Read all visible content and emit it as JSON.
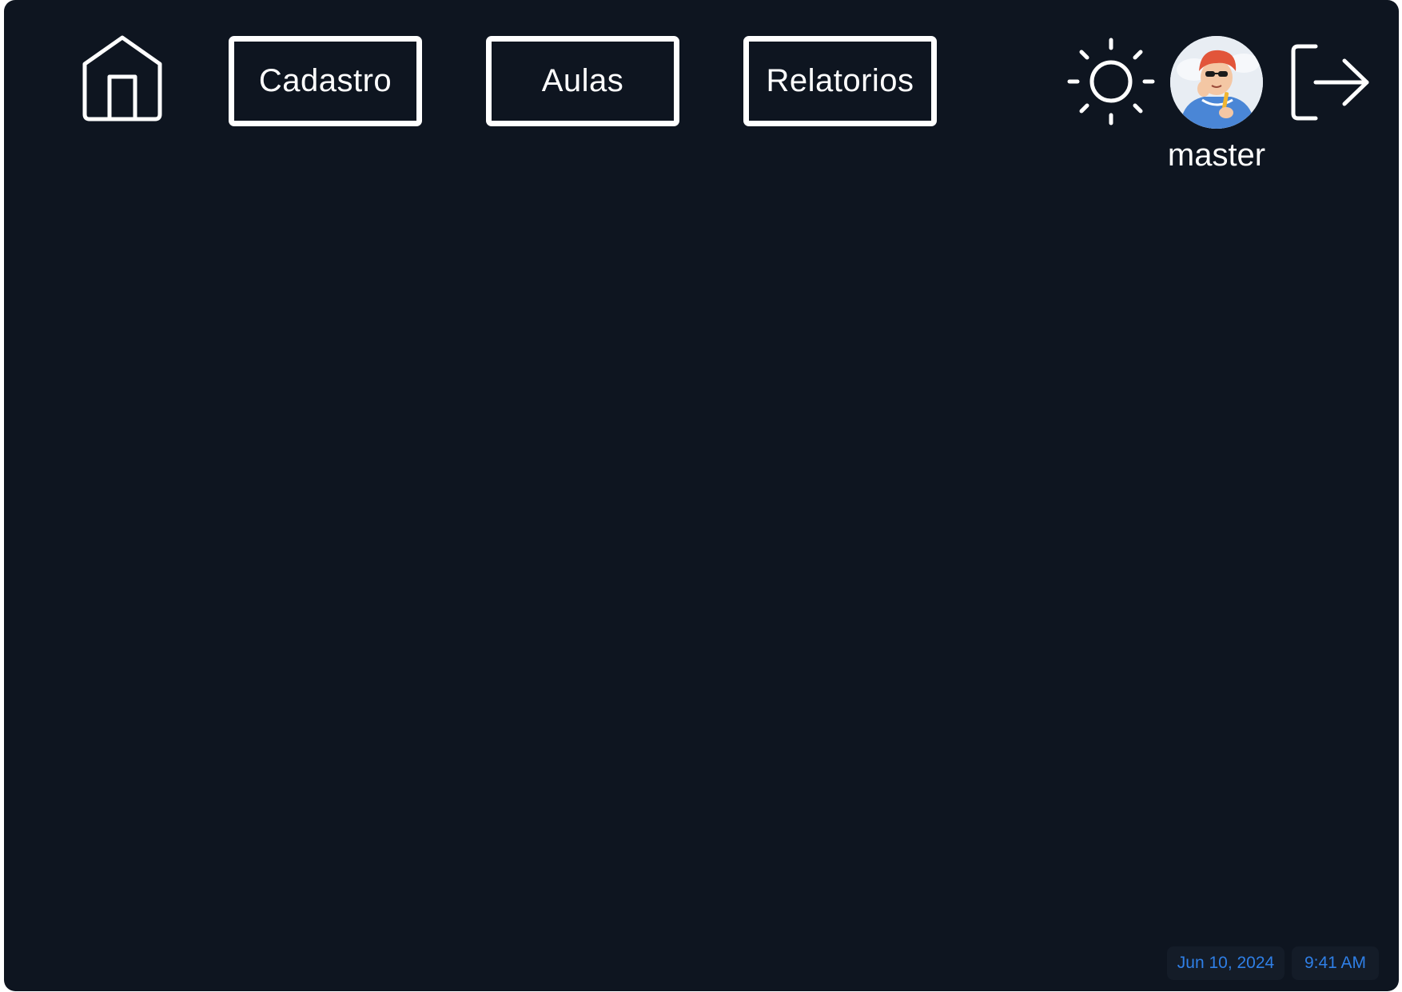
{
  "nav": {
    "home_icon": "home-icon",
    "buttons": [
      {
        "label": "Cadastro"
      },
      {
        "label": "Aulas"
      },
      {
        "label": "Relatorios"
      }
    ]
  },
  "user": {
    "theme_icon": "sun-icon",
    "avatar_icon": "user-avatar",
    "name": "master",
    "logout_icon": "logout-icon"
  },
  "status": {
    "date": "Jun 10, 2024",
    "time": "9:41 AM"
  },
  "colors": {
    "background": "#0e1520",
    "foreground": "#ffffff",
    "status_text": "#2f7fe6",
    "status_chip": "#141c28"
  }
}
